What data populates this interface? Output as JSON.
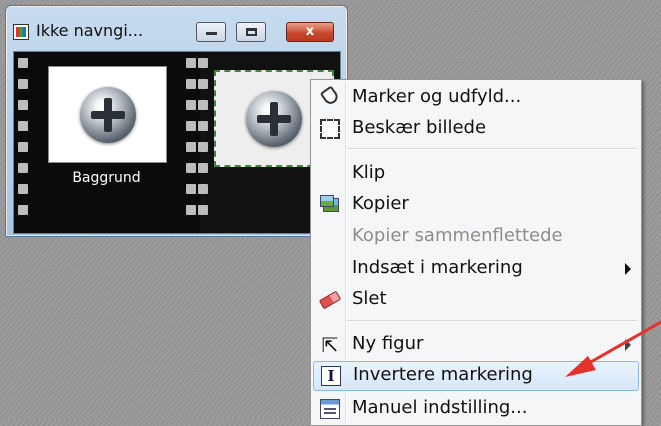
{
  "window": {
    "title": "Ikke navngi...",
    "buttons": {
      "minimize": "–",
      "maximize": "□",
      "close": "x"
    }
  },
  "layers": [
    {
      "label": "Baggrund"
    }
  ],
  "context_menu": {
    "items": [
      {
        "label": "Marker og udfyld...",
        "icon": "fill-bucket-icon",
        "enabled": true
      },
      {
        "label": "Beskær billede",
        "icon": "crop-icon",
        "enabled": true
      },
      {
        "label": "Klip",
        "icon": "",
        "enabled": true
      },
      {
        "label": "Kopier",
        "icon": "picture-icon",
        "enabled": true
      },
      {
        "label": "Kopier sammenflettede",
        "icon": "",
        "enabled": false
      },
      {
        "label": "Indsæt i markering",
        "icon": "",
        "enabled": true,
        "submenu": true
      },
      {
        "label": "Slet",
        "icon": "eraser-icon",
        "enabled": true
      },
      {
        "label": "Ny figur",
        "icon": "cursor-icon",
        "enabled": true,
        "submenu": true
      },
      {
        "label": "Invertere markering",
        "icon": "invert-icon",
        "enabled": true,
        "highlighted": true
      },
      {
        "label": "Manuel indstilling...",
        "icon": "manual-settings-icon",
        "enabled": true
      }
    ]
  },
  "annotation": {
    "arrow_color": "#e8302a"
  }
}
